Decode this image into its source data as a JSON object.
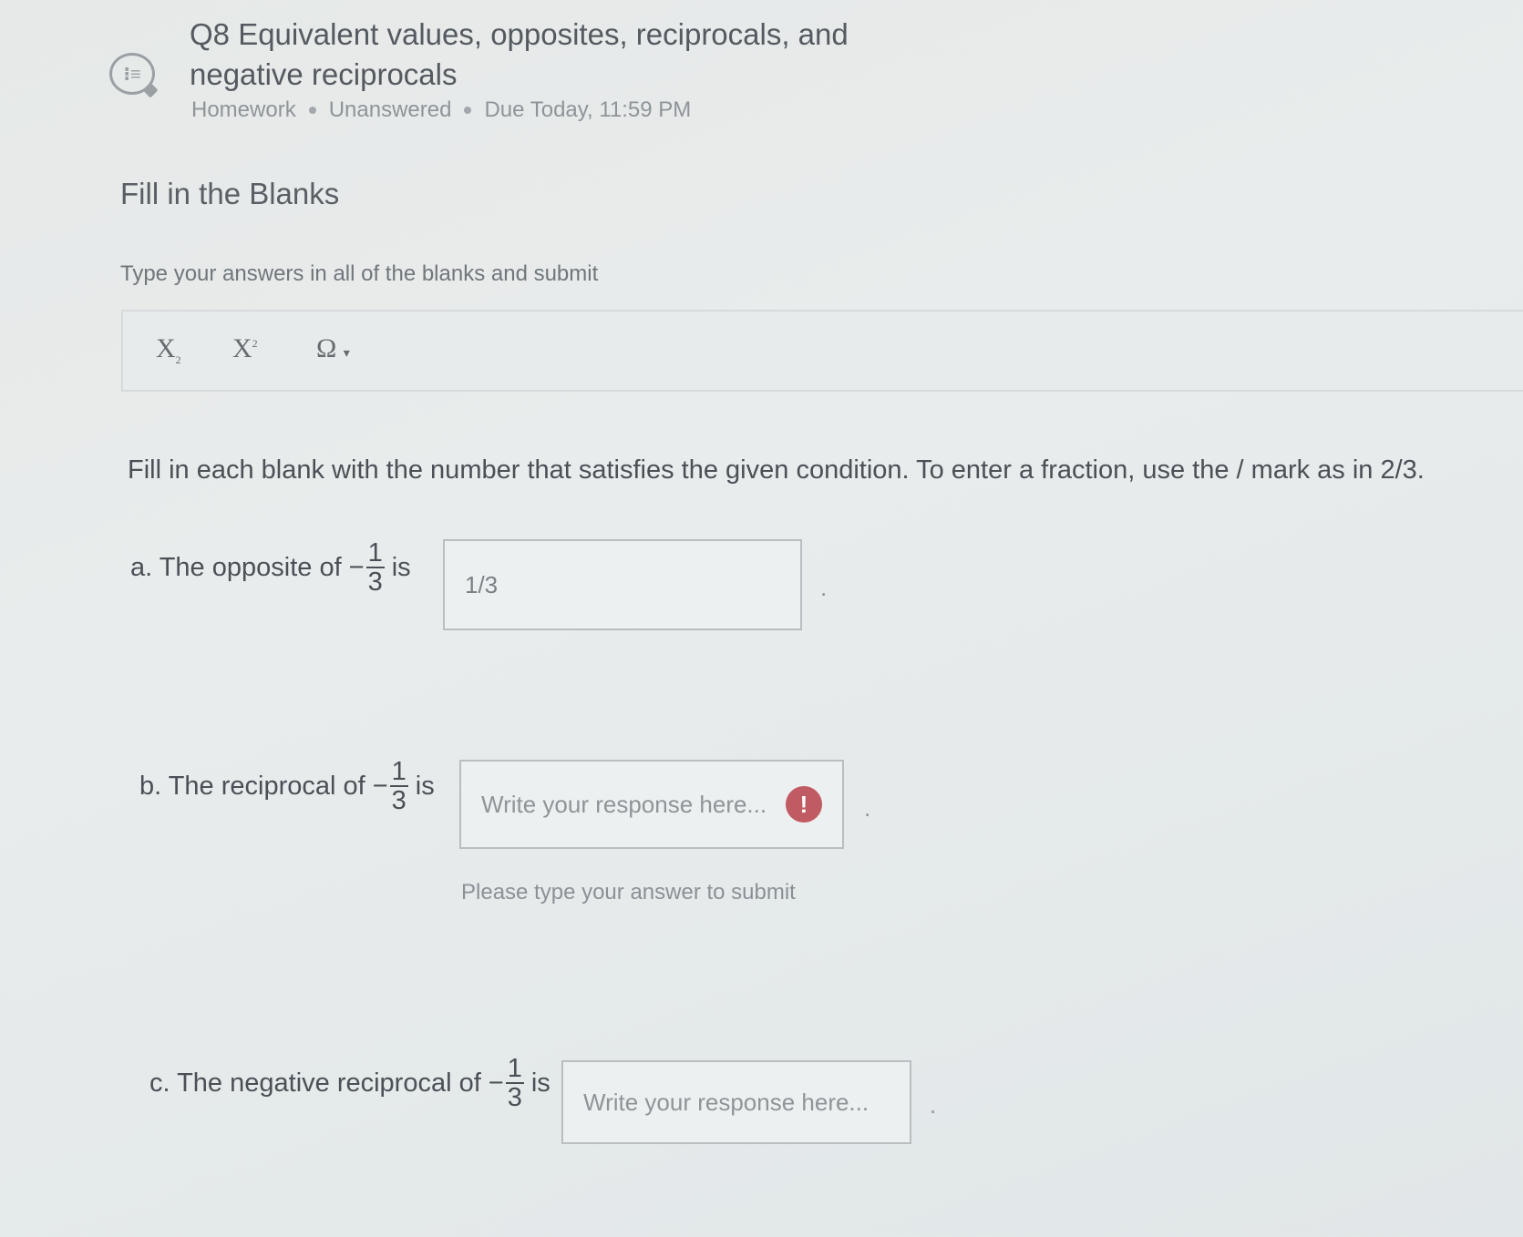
{
  "question": {
    "icon": "list-bubble-icon",
    "title": "Q8 Equivalent values, opposites, reciprocals, and negative reciprocals",
    "meta": [
      "Homework",
      "Unanswered",
      "Due Today, 11:59 PM"
    ]
  },
  "section": {
    "title": "Fill in the Blanks",
    "instructions": "Type your answers in all of the blanks and submit"
  },
  "toolbar": {
    "subscript": "X",
    "subscript_mark": "2",
    "superscript": "X",
    "superscript_mark": "2",
    "special_chars": "Ω",
    "special_chars_caret": "▾"
  },
  "prompt": "Fill in each blank with the number that satisfies the given condition. To enter a fraction, use the / mark as in 2/3.",
  "items": [
    {
      "label": "a. The opposite of",
      "sign": "−",
      "numerator": "1",
      "denominator": "3",
      "suffix": "is",
      "value": "1/3",
      "placeholder": "",
      "end": "."
    },
    {
      "label": "b. The reciprocal of",
      "sign": "−",
      "numerator": "1",
      "denominator": "3",
      "suffix": "is",
      "value": "",
      "placeholder": "Write your response here...",
      "warning": "!",
      "end": ".",
      "helper": "Please type your answer to submit"
    },
    {
      "label": "c. The negative reciprocal of",
      "sign": "−",
      "numerator": "1",
      "denominator": "3",
      "suffix": "is",
      "value": "",
      "placeholder": "Write your response here...",
      "end": "."
    }
  ]
}
